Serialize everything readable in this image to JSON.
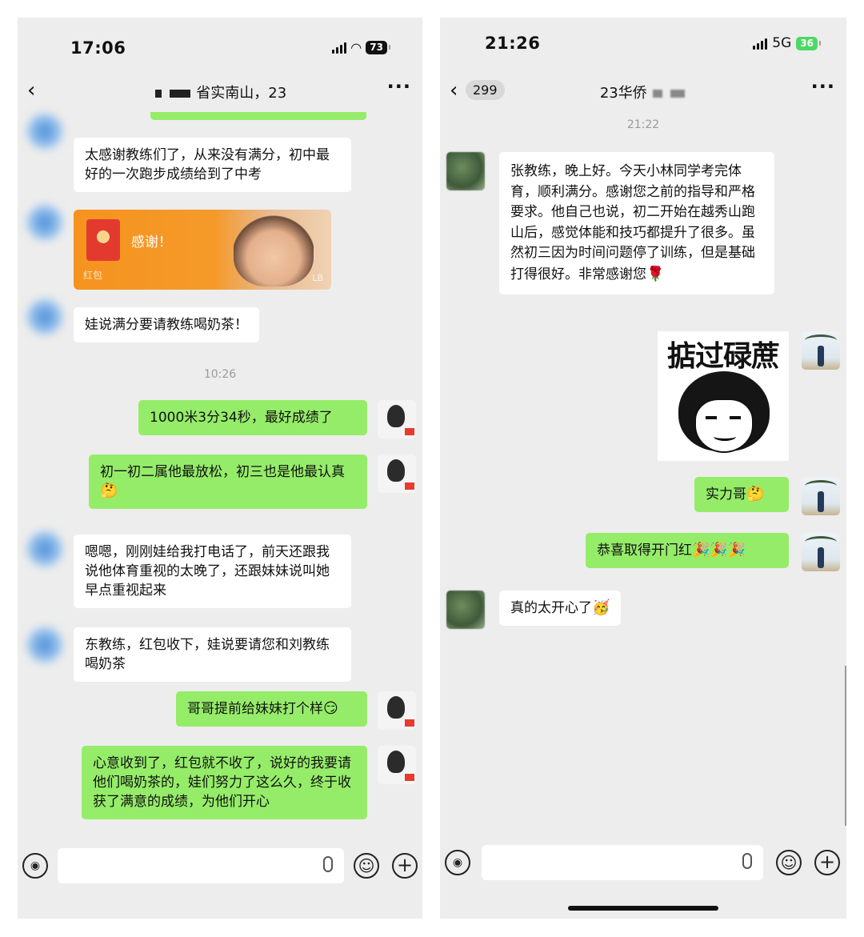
{
  "left": {
    "status": {
      "time": "17:06",
      "battery": "73"
    },
    "nav": {
      "title": "省实南山，23"
    },
    "messages": {
      "m1": "太感谢教练们了，从来没有满分，初中最好的一次跑步成绩给到了中考",
      "m3": "娃说满分要请教练喝奶茶！",
      "m4": "1000米3分34秒，最好成绩了",
      "m5": "初一初二属他最放松，初三也是他最认真",
      "m6": "嗯嗯，刚刚娃给我打电话了，前天还跟我说他体育重视的太晚了，还跟妹妹说叫她早点重视起来",
      "m7": "东教练，红包收下，娃说要请您和刘教练喝奶茶",
      "m8": "哥哥提前给妹妹打个样",
      "m9": "心意收到了，红包就不收了，说好的我要请他们喝奶茶的，娃们努力了这么久，终于收获了满意的成绩，为他们开心"
    },
    "redpacket": {
      "title": "感谢！",
      "sub": "红包",
      "mark": "LB"
    },
    "timestamp": "10:26",
    "icons": {
      "voice": "voice-icon",
      "emoji": "emoji-icon",
      "plus": "plus-icon",
      "mic": "mic-icon"
    }
  },
  "right": {
    "status": {
      "time": "21:26",
      "network": "5G",
      "battery": "36"
    },
    "nav": {
      "badge": "299",
      "title": "23华侨"
    },
    "timestamp": "21:22",
    "messages": {
      "r1": "张教练，晚上好。今天小林同学考完体育，顺利满分。感谢您之前的指导和严格要求。他自己也说，初二开始在越秀山跑山后，感觉体能和技巧都提升了很多。虽然初三因为时间问题停了训练，但是基础打得很好。非常感谢您",
      "r3": "实力哥",
      "r4": "恭喜取得开门红",
      "r5": "真的太开心了"
    },
    "sticker": {
      "text": "掂过碌蔗"
    },
    "accent": "#95ec69"
  }
}
